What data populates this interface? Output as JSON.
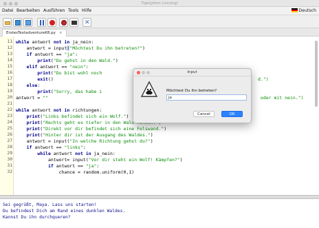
{
  "window": {
    "title": "TigerJython (running)"
  },
  "menu": {
    "items": [
      "Datei",
      "Bearbeiten",
      "Ausführen",
      "Tools",
      "Hilfe"
    ],
    "language": "Deutsch"
  },
  "toolbar": {
    "buttons": [
      "open-folder-icon",
      "save-icon",
      "save-as-icon",
      "pause-icon",
      "stop-icon",
      "debug-icon",
      "console-icon",
      "tools-icon"
    ]
  },
  "tab": {
    "filename": "ErstesTextadventureK8.py",
    "close": "×"
  },
  "editor": {
    "line_numbers": [
      "11",
      "12",
      "13",
      "14",
      "15",
      "16",
      "17",
      "18",
      "19",
      "20",
      "21",
      "22",
      "23",
      "24",
      "25",
      "26",
      "27",
      "28",
      "29",
      "30",
      "31",
      "32"
    ],
    "lines": [
      [
        {
          "k": "kw",
          "t": "while"
        },
        {
          "t": " antwort "
        },
        {
          "k": "kw",
          "t": "not in"
        },
        {
          "t": " ja_nein:"
        }
      ],
      [
        {
          "t": "    antwort = input"
        },
        {
          "k": "hl",
          "t": "("
        },
        {
          "k": "str",
          "t": "\"Möchtest Du ihn betreten?\""
        },
        {
          "t": ")"
        }
      ],
      [
        {
          "t": "    "
        },
        {
          "k": "kw",
          "t": "if"
        },
        {
          "t": " antwort == "
        },
        {
          "k": "str",
          "t": "\"ja\""
        },
        {
          "t": ":"
        }
      ],
      [
        {
          "t": "        "
        },
        {
          "k": "kw",
          "t": "print"
        },
        {
          "t": "("
        },
        {
          "k": "str",
          "t": "\"Du gehst in den Wald.\""
        },
        {
          "t": ")"
        }
      ],
      [
        {
          "t": "    "
        },
        {
          "k": "kw",
          "t": "elif"
        },
        {
          "t": " antwort == "
        },
        {
          "k": "str",
          "t": "\"nein\""
        },
        {
          "t": ":"
        }
      ],
      [
        {
          "t": "        "
        },
        {
          "k": "kw",
          "t": "print"
        },
        {
          "t": "("
        },
        {
          "k": "str",
          "t": "\"Du bist wohl noch"
        }
      ],
      [
        {
          "t": "        "
        },
        {
          "k": "kw",
          "t": "exit"
        },
        {
          "t": "()"
        }
      ],
      [
        {
          "t": "    "
        },
        {
          "k": "kw",
          "t": "else"
        },
        {
          "t": ":"
        }
      ],
      [
        {
          "t": "        "
        },
        {
          "k": "kw",
          "t": "print"
        },
        {
          "t": "("
        },
        {
          "k": "str",
          "t": "\"Sorry, das habe i"
        }
      ],
      [
        {
          "t": "antwort = "
        },
        {
          "k": "str",
          "t": "\"\""
        }
      ],
      [
        {
          "t": ""
        }
      ],
      [
        {
          "k": "kw",
          "t": "while"
        },
        {
          "t": " antwort "
        },
        {
          "k": "kw",
          "t": "not in"
        },
        {
          "t": " richtungen:"
        }
      ],
      [
        {
          "t": "    "
        },
        {
          "k": "kw",
          "t": "print"
        },
        {
          "t": "("
        },
        {
          "k": "str",
          "t": "\"Links befindet sich ein Wolf.\""
        },
        {
          "t": ")"
        }
      ],
      [
        {
          "t": "    "
        },
        {
          "k": "kw",
          "t": "print"
        },
        {
          "t": "("
        },
        {
          "k": "str",
          "t": "\"Rechts geht es tiefer in den Wald hinein.\""
        },
        {
          "t": ")"
        }
      ],
      [
        {
          "t": "    "
        },
        {
          "k": "kw",
          "t": "print"
        },
        {
          "t": "("
        },
        {
          "k": "str",
          "t": "\"Direkt vor dir befindet sich eine Felswand.\""
        },
        {
          "t": ")"
        }
      ],
      [
        {
          "t": "    "
        },
        {
          "k": "kw",
          "t": "print"
        },
        {
          "t": "("
        },
        {
          "k": "str",
          "t": "\"Hinter dir ist der Ausgang des Waldes.\""
        },
        {
          "t": ")"
        }
      ],
      [
        {
          "t": "    antwort = input("
        },
        {
          "k": "str",
          "t": "\"In welche Richtung gehst du?\""
        },
        {
          "t": ")"
        }
      ],
      [
        {
          "t": "    "
        },
        {
          "k": "kw",
          "t": "if"
        },
        {
          "t": " antwort == "
        },
        {
          "k": "str",
          "t": "\"links\""
        },
        {
          "t": ":"
        }
      ],
      [
        {
          "t": "        "
        },
        {
          "k": "kw",
          "t": "while"
        },
        {
          "t": " antwort "
        },
        {
          "k": "kw",
          "t": "not in"
        },
        {
          "t": " ja_nein:"
        }
      ],
      [
        {
          "t": "            antwort= input("
        },
        {
          "k": "str",
          "t": "\"Vor dir steht ein Wolf! Kämpfen?\""
        },
        {
          "t": ")"
        }
      ],
      [
        {
          "t": "            "
        },
        {
          "k": "kw",
          "t": "if"
        },
        {
          "t": " antwort == "
        },
        {
          "k": "str",
          "t": "\"ja\""
        },
        {
          "t": ":"
        }
      ],
      [
        {
          "t": "                chance = random.uniform(0,1)"
        }
      ]
    ],
    "overflow_16": "d.\")",
    "overflow_19": " oder mit nein.\")"
  },
  "console": {
    "lines": [
      "Sei gegrüßt, Maya. Lass uns starten!",
      "Du befindest Dich am Rand eines dunklen Waldes.",
      "Kannst Du ihn durchqueren?"
    ]
  },
  "dialog": {
    "title": "Input",
    "prompt": "Möchtest Du ihn betreten?",
    "value": "ja",
    "cancel": "Cancel",
    "ok": "OK"
  },
  "colors": {
    "keyword": "#00008b",
    "string": "#0a8c0a",
    "ok_button": "#2a82ff",
    "console_text": "#101090"
  }
}
